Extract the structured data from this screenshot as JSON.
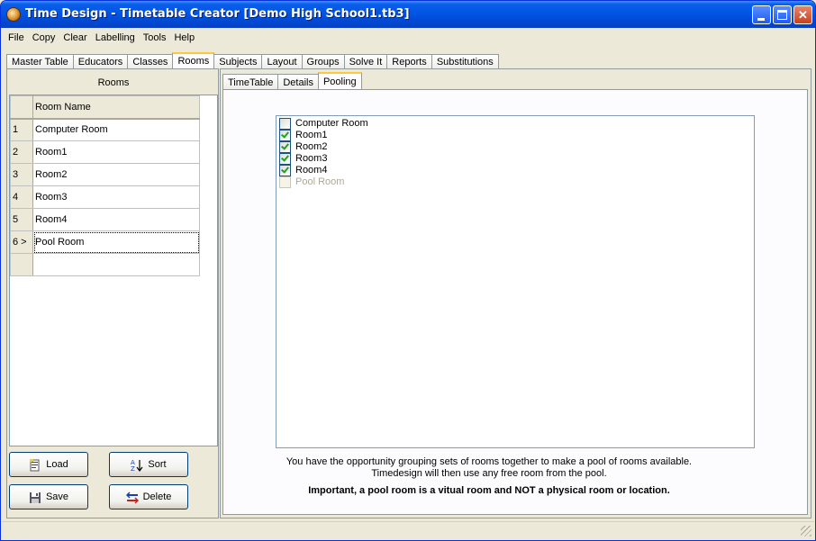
{
  "window": {
    "title": "Time Design - Timetable Creator [Demo High School1.tb3]"
  },
  "menu": [
    "File",
    "Copy",
    "Clear",
    "Labelling",
    "Tools",
    "Help"
  ],
  "main_tabs": [
    {
      "label": "Master Table",
      "active": false
    },
    {
      "label": "Educators",
      "active": false
    },
    {
      "label": "Classes",
      "active": false
    },
    {
      "label": "Rooms",
      "active": true
    },
    {
      "label": "Subjects",
      "active": false
    },
    {
      "label": "Layout",
      "active": false
    },
    {
      "label": "Groups",
      "active": false
    },
    {
      "label": "Solve It",
      "active": false
    },
    {
      "label": "Reports",
      "active": false
    },
    {
      "label": "Substitutions",
      "active": false
    }
  ],
  "rooms_panel": {
    "caption": "Rooms",
    "column_header": "Room Name",
    "rows": [
      {
        "num": "1",
        "name": "Computer Room"
      },
      {
        "num": "2",
        "name": "Room1"
      },
      {
        "num": "3",
        "name": "Room2"
      },
      {
        "num": "4",
        "name": "Room3"
      },
      {
        "num": "5",
        "name": "Room4"
      },
      {
        "num": "6 >",
        "name": "Pool Room"
      },
      {
        "num": "",
        "name": ""
      }
    ],
    "buttons": {
      "load": "Load",
      "sort": "Sort",
      "save": "Save",
      "delete": "Delete"
    }
  },
  "sub_tabs": [
    {
      "label": "TimeTable",
      "active": false
    },
    {
      "label": "Details",
      "active": false
    },
    {
      "label": "Pooling",
      "active": true
    }
  ],
  "pooling": {
    "items": [
      {
        "label": "Computer Room",
        "checked": false,
        "enabled": true
      },
      {
        "label": "Room1",
        "checked": true,
        "enabled": true
      },
      {
        "label": "Room2",
        "checked": true,
        "enabled": true
      },
      {
        "label": "Room3",
        "checked": true,
        "enabled": true
      },
      {
        "label": "Room4",
        "checked": true,
        "enabled": true
      },
      {
        "label": "Pool Room",
        "checked": false,
        "enabled": false
      }
    ],
    "info_line1": "You have the opportunity grouping sets of rooms together to make a pool of rooms available.",
    "info_line2": "Timedesign will then use any free room from the pool.",
    "important": "Important, a pool room is a vitual room and NOT a physical room or location."
  },
  "colors": {
    "title_bar": "#0055e5",
    "active_tab_accent": "#ffc83c",
    "check_green": "#21a121"
  }
}
